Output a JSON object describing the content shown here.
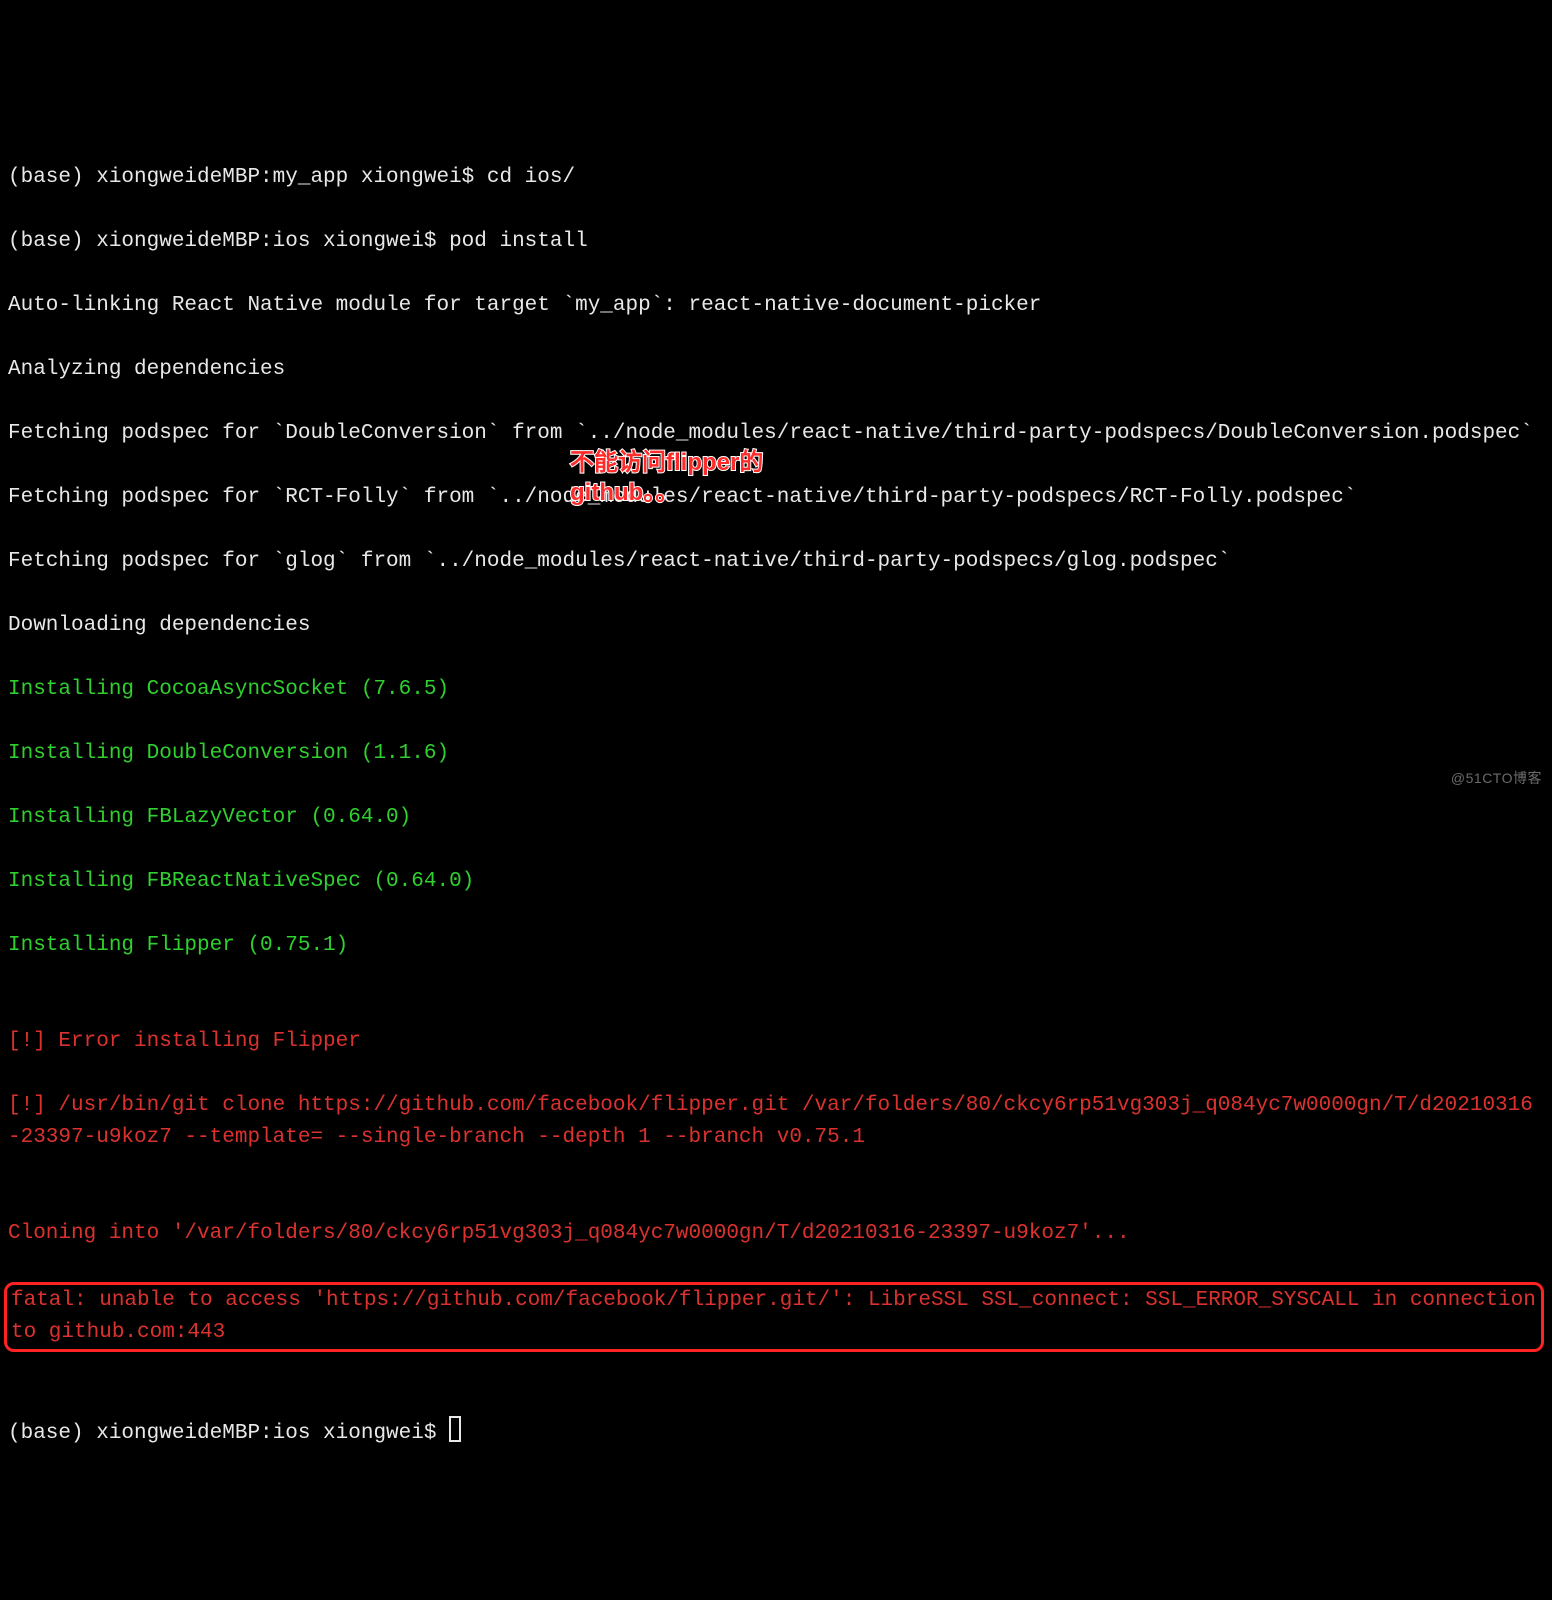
{
  "lines": {
    "l01": "(base) xiongweideMBP:my_app xiongwei$ cd ios/",
    "l02": "(base) xiongweideMBP:ios xiongwei$ pod install",
    "l03": "Auto-linking React Native module for target `my_app`: react-native-document-picker",
    "l04": "Analyzing dependencies",
    "l05": "Fetching podspec for `DoubleConversion` from `../node_modules/react-native/third-party-podspecs/DoubleConversion.podspec`",
    "l06": "Fetching podspec for `RCT-Folly` from `../node_modules/react-native/third-party-podspecs/RCT-Folly.podspec`",
    "l07": "Fetching podspec for `glog` from `../node_modules/react-native/third-party-podspecs/glog.podspec`",
    "l08": "Downloading dependencies",
    "g01": "Installing CocoaAsyncSocket (7.6.5)",
    "g02": "Installing DoubleConversion (1.1.6)",
    "g03": "Installing FBLazyVector (0.64.0)",
    "g04": "Installing FBReactNativeSpec (0.64.0)",
    "g05": "Installing Flipper (0.75.1)",
    "blank": "",
    "r01": "[!] Error installing Flipper",
    "r02": "[!] /usr/bin/git clone https://github.com/facebook/flipper.git /var/folders/80/ckcy6rp51vg303j_q084yc7w0000gn/T/d20210316-23397-u9koz7 --template= --single-branch --depth 1 --branch v0.75.1",
    "r03": "Cloning into '/var/folders/80/ckcy6rp51vg303j_q084yc7w0000gn/T/d20210316-23397-u9koz7'...",
    "r04": "fatal: unable to access 'https://github.com/facebook/flipper.git/': LibreSSL SSL_connect: SSL_ERROR_SYSCALL in connection to github.com:443",
    "prompt_end": "(base) xiongweideMBP:ios xiongwei$ "
  },
  "annotation": {
    "line1": "不能访问flipper的",
    "line2": "github。。"
  },
  "watermark": "@51CTO博客"
}
